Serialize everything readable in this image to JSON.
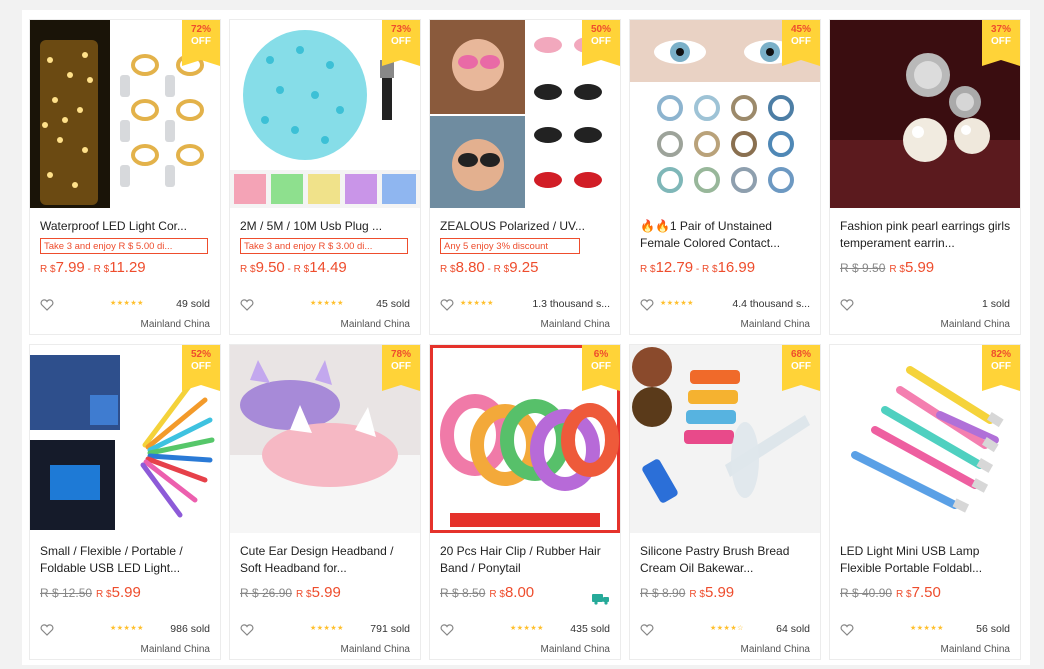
{
  "products": [
    {
      "title": "Waterproof LED Light Cor...",
      "promo": "Take 3 and enjoy R $ 5.00 di...",
      "price_old": "",
      "price": "7.99",
      "price_high": "11.29",
      "discount": "72%",
      "off": "OFF",
      "stars": "★★★★★",
      "sold": "49 sold",
      "location": "Mainland China",
      "icon": "heart-icon"
    },
    {
      "title": "2M / 5M / 10M Usb Plug ...",
      "promo": "Take 3 and enjoy R $ 3.00 di...",
      "price_old": "",
      "price": "9.50",
      "price_high": "14.49",
      "discount": "73%",
      "off": "OFF",
      "stars": "★★★★★",
      "sold": "45 sold",
      "location": "Mainland China",
      "icon": "heart-icon"
    },
    {
      "title": "ZEALOUS Polarized / UV...",
      "promo": "Any 5 enjoy 3% discount",
      "price_old": "",
      "price": "8.80",
      "price_high": "9.25",
      "discount": "50%",
      "off": "OFF",
      "stars": "★★★★★",
      "sold": "1.3 thousand s...",
      "location": "Mainland China",
      "icon": "heart-icon"
    },
    {
      "title": "🔥🔥1 Pair of Unstained Female Colored Contact...",
      "promo": "",
      "price_old": "",
      "price": "12.79",
      "price_high": "16.99",
      "discount": "45%",
      "off": "OFF",
      "stars": "★★★★★",
      "sold": "4.4 thousand s...",
      "location": "Mainland China",
      "icon": "heart-icon"
    },
    {
      "title": "Fashion pink pearl earrings girls temperament earrin...",
      "promo": "",
      "price_old": "R $ 9.50",
      "price": "5.99",
      "price_high": "",
      "discount": "37%",
      "off": "OFF",
      "stars": "",
      "sold": "1 sold",
      "location": "Mainland China",
      "icon": "heart-icon"
    },
    {
      "title": "Small / Flexible / Portable / Foldable USB LED Light...",
      "promo": "",
      "price_old": "R $ 12.50",
      "price": "5.99",
      "price_high": "",
      "discount": "52%",
      "off": "OFF",
      "stars": "★★★★★",
      "sold": "986 sold",
      "location": "Mainland China",
      "icon": "heart-icon"
    },
    {
      "title": "Cute Ear Design Headband / Soft Headband for...",
      "promo": "",
      "price_old": "R $ 26.90",
      "price": "5.99",
      "price_high": "",
      "discount": "78%",
      "off": "OFF",
      "stars": "★★★★★",
      "sold": "791 sold",
      "location": "Mainland China",
      "icon": "heart-icon"
    },
    {
      "title": "20 Pcs Hair Clip / Rubber Hair Band / Ponytail",
      "promo": "",
      "price_old": "R $ 8.50",
      "price": "8.00",
      "price_high": "",
      "discount": "6%",
      "off": "OFF",
      "stars": "★★★★★",
      "sold": "435 sold",
      "location": "Mainland China",
      "icon": "heart-icon"
    },
    {
      "title": "Silicone Pastry Brush Bread Cream Oil Bakewar...",
      "promo": "",
      "price_old": "R $ 8.90",
      "price": "5.99",
      "price_high": "",
      "discount": "68%",
      "off": "OFF",
      "stars": "★★★★☆",
      "sold": "64 sold",
      "location": "Mainland China",
      "icon": "heart-icon"
    },
    {
      "title": "LED Light Mini USB Lamp Flexible Portable Foldabl...",
      "promo": "",
      "price_old": "R $ 40.90",
      "price": "7.50",
      "price_high": "",
      "discount": "82%",
      "off": "OFF",
      "stars": "★★★★★",
      "sold": "56 sold",
      "location": "Mainland China",
      "icon": "heart-icon"
    }
  ],
  "currency": "R $",
  "price_sep": " - ",
  "colors": {
    "accent": "#ee4d2d",
    "badge": "#ffd338",
    "stars": "#ffc02e"
  }
}
